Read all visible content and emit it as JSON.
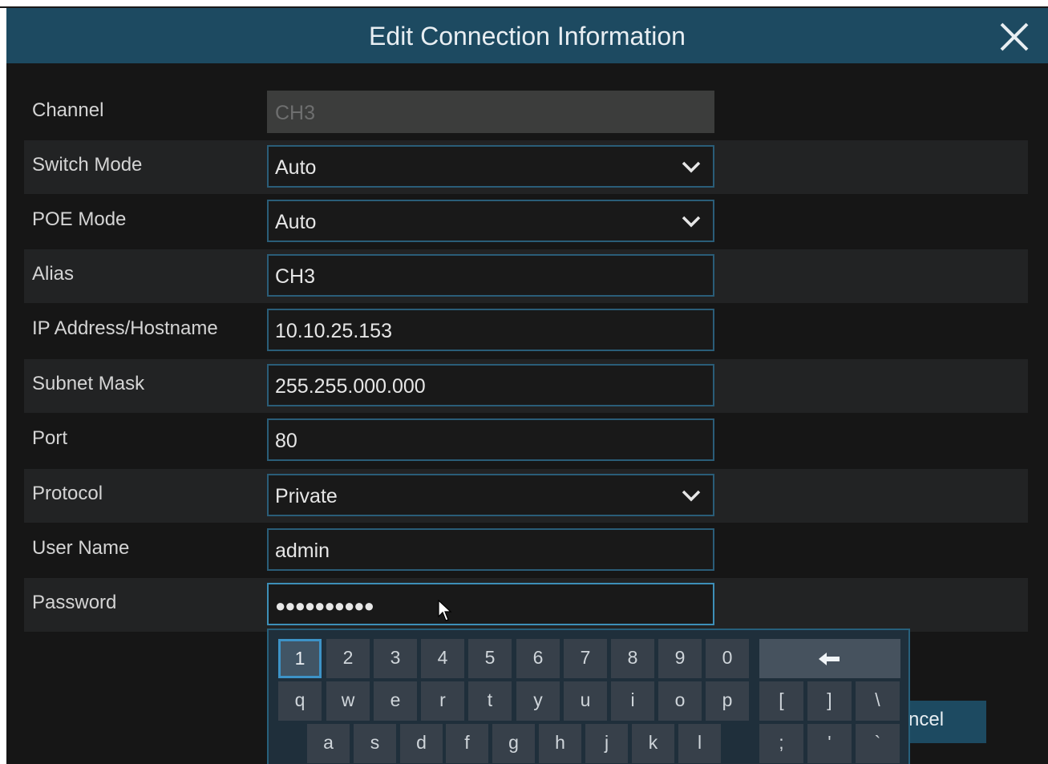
{
  "dialog": {
    "title": "Edit Connection Information",
    "close_icon": "close-x-icon"
  },
  "form": {
    "channel": {
      "label": "Channel",
      "value": "CH3"
    },
    "switch_mode": {
      "label": "Switch Mode",
      "value": "Auto"
    },
    "poe_mode": {
      "label": "POE Mode",
      "value": "Auto"
    },
    "alias": {
      "label": "Alias",
      "value": "CH3"
    },
    "ip_address": {
      "label": "IP Address/Hostname",
      "value": "10.10.25.153"
    },
    "subnet_mask": {
      "label": "Subnet Mask",
      "value": "255.255.000.000"
    },
    "port": {
      "label": "Port",
      "value": "80"
    },
    "protocol": {
      "label": "Protocol",
      "value": "Private"
    },
    "user_name": {
      "label": "User Name",
      "value": "admin"
    },
    "password": {
      "label": "Password",
      "value": "●●●●●●●●●●"
    }
  },
  "buttons": {
    "cancel_partial": "ncel"
  },
  "keyboard": {
    "row1": [
      "1",
      "2",
      "3",
      "4",
      "5",
      "6",
      "7",
      "8",
      "9",
      "0"
    ],
    "row2": [
      "q",
      "w",
      "e",
      "r",
      "t",
      "y",
      "u",
      "i",
      "o",
      "p"
    ],
    "row2_symbols": [
      "[",
      "]",
      "\\"
    ],
    "row3": [
      "a",
      "s",
      "d",
      "f",
      "g",
      "h",
      "j",
      "k",
      "l"
    ],
    "row3_symbols": [
      ";",
      "'",
      "`"
    ],
    "backspace_icon": "backspace-arrow-icon",
    "selected_key": "1"
  },
  "colors": {
    "title_bar": "#1d4a61",
    "background": "#161616",
    "field_border": "#2a5d78",
    "selected_key_border": "#3d93c7"
  }
}
